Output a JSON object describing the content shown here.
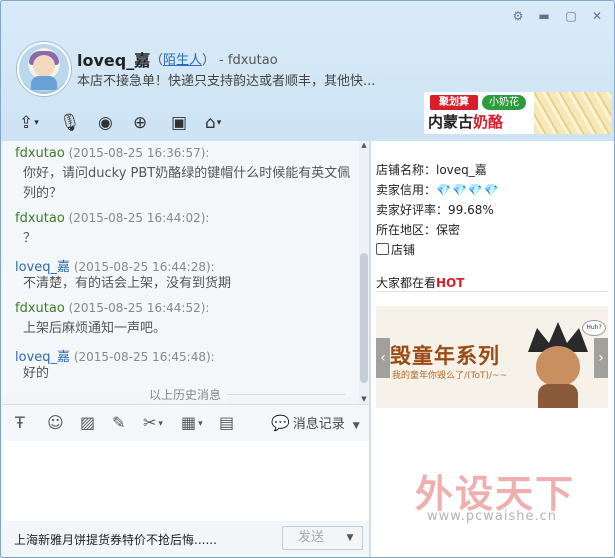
{
  "window": {
    "controls": {
      "settings": "⚙",
      "minimize": "▬",
      "maximize": "▢",
      "close": "✕"
    }
  },
  "header": {
    "name": "loveq_嘉",
    "paren_open": "（",
    "relation": "陌生人",
    "paren_close": "）",
    "account": "- fdxutao",
    "signature": "本店不接急单！快递只支持韵达或者顺丰，其他快..."
  },
  "banner": {
    "tag": "聚划算",
    "brand": "小奶花",
    "headline_a": "内蒙古",
    "headline_b": "奶酪"
  },
  "messages": [
    {
      "author": "fdxutao",
      "role": "other",
      "time": "(2015-08-25 16:36:57):",
      "text": "你好，请问ducky PBT奶酪绿的键帽什么时候能有英文佩列的？"
    },
    {
      "author": "fdxutao",
      "role": "other",
      "time": "(2015-08-25 16:44:02):",
      "text": "？"
    },
    {
      "author": "loveq_嘉",
      "role": "self",
      "time": "(2015-08-25 16:44:28):",
      "text": "不清楚，有的话会上架，没有到货期"
    },
    {
      "author": "fdxutao",
      "role": "other",
      "time": "(2015-08-25 16:44:52):",
      "text": "上架后麻烦通知一声吧。"
    },
    {
      "author": "loveq_嘉",
      "role": "self",
      "time": "(2015-08-25 16:45:48):",
      "text": "好的"
    }
  ],
  "history_label": "以上历史消息",
  "record_label": "消息记录",
  "quick_text": "上海新雅月饼提货券特价不抢后悔......",
  "send_label": "发送",
  "shop": {
    "name_label": "店铺名称：loveq_嘉",
    "credit_label": "卖家信用：",
    "credit_icons": "💎💎💎💎",
    "rate_label": "卖家好评率：99.68%",
    "region_label": "所在地区：保密",
    "shop_link": "店铺"
  },
  "watching": {
    "prefix": "大家都在看",
    "hot": "HOT"
  },
  "promo": {
    "title": "毁童年系列",
    "subtitle": "我的童年你毁么了/(ToT)/~~",
    "bubble": "Huh?"
  },
  "watermark": {
    "brand": "外设天下",
    "url": "www.pcwaishe.cn"
  },
  "icons": {
    "toolbar_top": [
      "share-icon",
      "microphone-icon",
      "camera-icon",
      "add-person-icon",
      "screen-share-icon",
      "remote-assist-icon"
    ],
    "toolbar_bottom": [
      "font-icon",
      "emoji-icon",
      "image-icon",
      "edit-icon",
      "scissors-icon",
      "table-icon",
      "screenshot-icon",
      "message-record-icon"
    ]
  },
  "colors": {
    "self": "#2b6cae",
    "other": "#3a7d28",
    "hot": "#d81e2a",
    "accent": "#7fa7c9"
  }
}
